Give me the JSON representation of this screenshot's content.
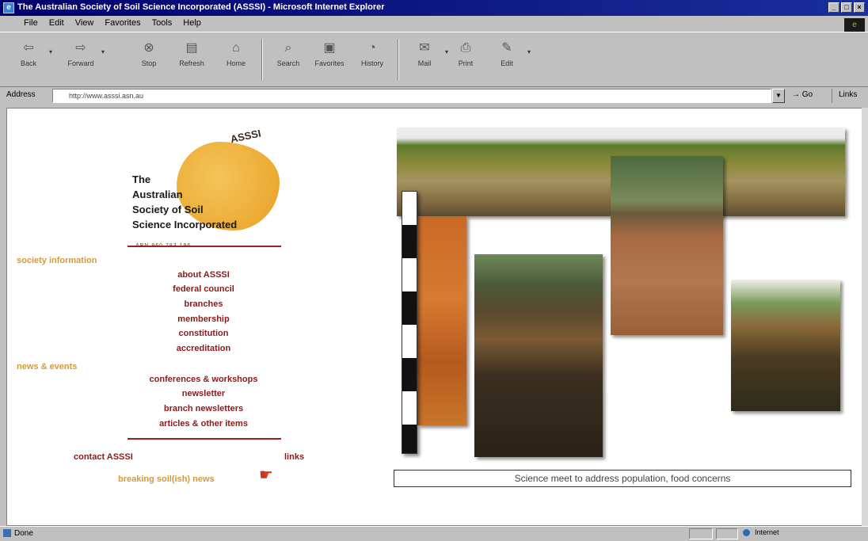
{
  "window": {
    "title": "The Australian Society of Soil Science Incorporated (ASSSI) - Microsoft Internet Explorer",
    "controls": [
      "minimize-icon",
      "maximize-icon",
      "close-icon"
    ]
  },
  "menubar": [
    "File",
    "Edit",
    "View",
    "Favorites",
    "Tools",
    "Help"
  ],
  "toolbar": [
    {
      "label": "Back",
      "icon": "back-arrow-icon"
    },
    {
      "label": "Forward",
      "icon": "forward-arrow-icon"
    },
    {
      "label": "Stop",
      "icon": "stop-icon"
    },
    {
      "label": "Refresh",
      "icon": "refresh-icon"
    },
    {
      "label": "Home",
      "icon": "home-icon"
    },
    {
      "label": "Search",
      "icon": "search-icon"
    },
    {
      "label": "Favorites",
      "icon": "favorites-icon"
    },
    {
      "label": "History",
      "icon": "history-icon"
    },
    {
      "label": "Mail",
      "icon": "mail-icon"
    },
    {
      "label": "Print",
      "icon": "print-icon"
    },
    {
      "label": "Edit",
      "icon": "edit-icon"
    }
  ],
  "address": {
    "label": "Address",
    "url": "http://www.asssi.asn.au",
    "go": "Go",
    "links": "Links"
  },
  "logo": {
    "lines": [
      "The",
      "Australian",
      "Society of Soil",
      "Science Incorporated"
    ],
    "abn": "ABN 960 783 196",
    "acronym": "ASSSI"
  },
  "nav": {
    "society_heading": "society information",
    "society_links": [
      "about ASSSI",
      "federal council",
      "branches",
      "membership",
      "constitution",
      "accreditation"
    ],
    "news_heading": "news & events",
    "news_links": [
      "conferences & workshops",
      "newsletter",
      "branch newsletters",
      "articles & other items"
    ],
    "contact": "contact ASSSI",
    "links": "links",
    "breaking": "breaking soil(ish) news"
  },
  "caption": "Science meet to address population, food concerns",
  "status": {
    "text": "Done",
    "zone": "Internet"
  },
  "colors": {
    "nav_link": "#8b1a1a",
    "section_heading": "#d49a3a",
    "rule": "#9c2020",
    "titlebar": "#00006e"
  }
}
